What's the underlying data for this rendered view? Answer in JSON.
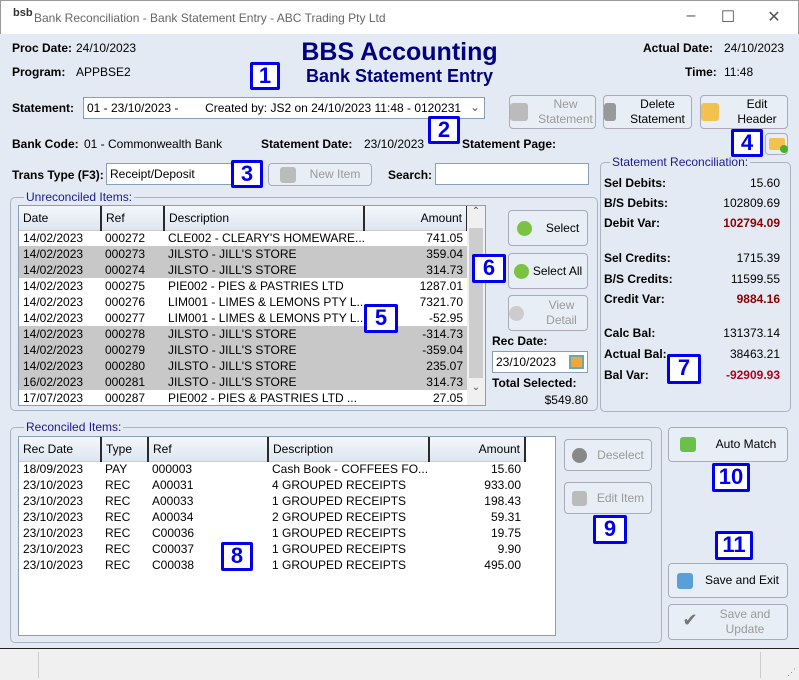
{
  "window": {
    "title": "Bank Reconciliation - Bank Statement Entry - ABC Trading Pty Ltd",
    "logo": "bsb",
    "minimize": "–",
    "maximize": "☐",
    "close": "✕"
  },
  "header": {
    "proc_date_label": "Proc Date:",
    "proc_date": "24/10/2023",
    "program_label": "Program:",
    "program": "APPBSE2",
    "app_title": "BBS Accounting",
    "screen_title": "Bank Statement Entry",
    "actual_date_label": "Actual Date:",
    "actual_date": "24/10/2023",
    "time_label": "Time:",
    "time": "11:48"
  },
  "statement": {
    "label": "Statement:",
    "value": "01 - 23/10/2023 -        Created by: JS2 on 24/10/2023 11:48 - 0120231"
  },
  "toolbar": {
    "new_statement": "New Statement",
    "delete_statement": "Delete Statement",
    "edit_header": "Edit Header"
  },
  "info": {
    "bank_code_label": "Bank Code:",
    "bank_code": "01 - Commonwealth Bank",
    "statement_date_label": "Statement Date:",
    "statement_date": "23/10/2023",
    "statement_page_label": "Statement Page:"
  },
  "trans": {
    "label": "Trans Type (F3):",
    "value": "Receipt/Deposit",
    "new_item": "New Item",
    "search_label": "Search:",
    "search_value": ""
  },
  "unreconciled": {
    "title": "Unreconciled Items:",
    "columns": [
      "Date",
      "Ref",
      "Description",
      "Amount"
    ],
    "rows": [
      {
        "date": "14/02/2023",
        "ref": "000272",
        "desc": "CLE002 - CLEARY'S HOMEWARE...",
        "amount": "741.05",
        "selected": false
      },
      {
        "date": "14/02/2023",
        "ref": "000273",
        "desc": "JILSTO - JILL'S STORE",
        "amount": "359.04",
        "selected": true
      },
      {
        "date": "14/02/2023",
        "ref": "000274",
        "desc": "JILSTO - JILL'S STORE",
        "amount": "314.73",
        "selected": true
      },
      {
        "date": "14/02/2023",
        "ref": "000275",
        "desc": "PIE002 - PIES & PASTRIES LTD",
        "amount": "1287.01",
        "selected": false
      },
      {
        "date": "14/02/2023",
        "ref": "000276",
        "desc": "LIM001 - LIMES & LEMONS PTY L...",
        "amount": "7321.70",
        "selected": false
      },
      {
        "date": "14/02/2023",
        "ref": "000277",
        "desc": "LIM001 - LIMES & LEMONS PTY L...",
        "amount": "-52.95",
        "selected": false
      },
      {
        "date": "14/02/2023",
        "ref": "000278",
        "desc": "JILSTO - JILL'S STORE",
        "amount": "-314.73",
        "selected": true
      },
      {
        "date": "14/02/2023",
        "ref": "000279",
        "desc": "JILSTO - JILL'S STORE",
        "amount": "-359.04",
        "selected": true
      },
      {
        "date": "14/02/2023",
        "ref": "000280",
        "desc": "JILSTO - JILL'S STORE",
        "amount": "235.07",
        "selected": true
      },
      {
        "date": "16/02/2023",
        "ref": "000281",
        "desc": "JILSTO - JILL'S STORE",
        "amount": "314.73",
        "selected": true
      },
      {
        "date": "17/07/2023",
        "ref": "000287",
        "desc": "PIE002 - PIES & PASTRIES LTD  ...",
        "amount": "27.05",
        "selected": false
      }
    ]
  },
  "actions": {
    "select": "Select",
    "select_all": "Select All",
    "view_detail": "View Detail",
    "rec_date_label": "Rec Date:",
    "rec_date": "23/10/2023",
    "total_selected_label": "Total Selected:",
    "total_selected": "$549.80"
  },
  "reconciliation": {
    "title": "Statement Reconciliation:",
    "sel_debits_label": "Sel Debits:",
    "sel_debits": "15.60",
    "bs_debits_label": "B/S Debits:",
    "bs_debits": "102809.69",
    "debit_var_label": "Debit Var:",
    "debit_var": "102794.09",
    "sel_credits_label": "Sel Credits:",
    "sel_credits": "1715.39",
    "bs_credits_label": "B/S Credits:",
    "bs_credits": "11599.55",
    "credit_var_label": "Credit Var:",
    "credit_var": "9884.16",
    "calc_bal_label": "Calc Bal:",
    "calc_bal": "131373.14",
    "actual_bal_label": "Actual Bal:",
    "actual_bal": "38463.21",
    "bal_var_label": "Bal Var:",
    "bal_var": "-92909.93"
  },
  "reconciled": {
    "title": "Reconciled Items:",
    "columns": [
      "Rec Date",
      "Type",
      "Ref",
      "Description",
      "Amount"
    ],
    "rows": [
      {
        "date": "18/09/2023",
        "type": "PAY",
        "ref": "000003",
        "desc": "Cash Book - COFFEES FO...",
        "amount": "15.60"
      },
      {
        "date": "23/10/2023",
        "type": "REC",
        "ref": "A00031",
        "desc": "4 GROUPED RECEIPTS",
        "amount": "933.00"
      },
      {
        "date": "23/10/2023",
        "type": "REC",
        "ref": "A00033",
        "desc": "1 GROUPED RECEIPTS",
        "amount": "198.43"
      },
      {
        "date": "23/10/2023",
        "type": "REC",
        "ref": "A00034",
        "desc": "2 GROUPED RECEIPTS",
        "amount": "59.31"
      },
      {
        "date": "23/10/2023",
        "type": "REC",
        "ref": "C00036",
        "desc": "1 GROUPED RECEIPTS",
        "amount": "19.75"
      },
      {
        "date": "23/10/2023",
        "type": "REC",
        "ref": "C00037",
        "desc": "1 GROUPED RECEIPTS",
        "amount": "9.90"
      },
      {
        "date": "23/10/2023",
        "type": "REC",
        "ref": "C00038",
        "desc": "1 GROUPED RECEIPTS",
        "amount": "495.00"
      }
    ]
  },
  "rec_actions": {
    "deselect": "Deselect",
    "edit_item": "Edit Item",
    "auto_match": "Auto Match",
    "save_exit": "Save and Exit",
    "save_update": "Save and Update"
  },
  "markers": [
    "1",
    "2",
    "3",
    "4",
    "5",
    "6",
    "7",
    "8",
    "9",
    "10",
    "11"
  ],
  "colors": {
    "title": "#000080",
    "variance": "#8b0000",
    "selected_row": "#c8c8c8",
    "marker": "#0000ee"
  }
}
